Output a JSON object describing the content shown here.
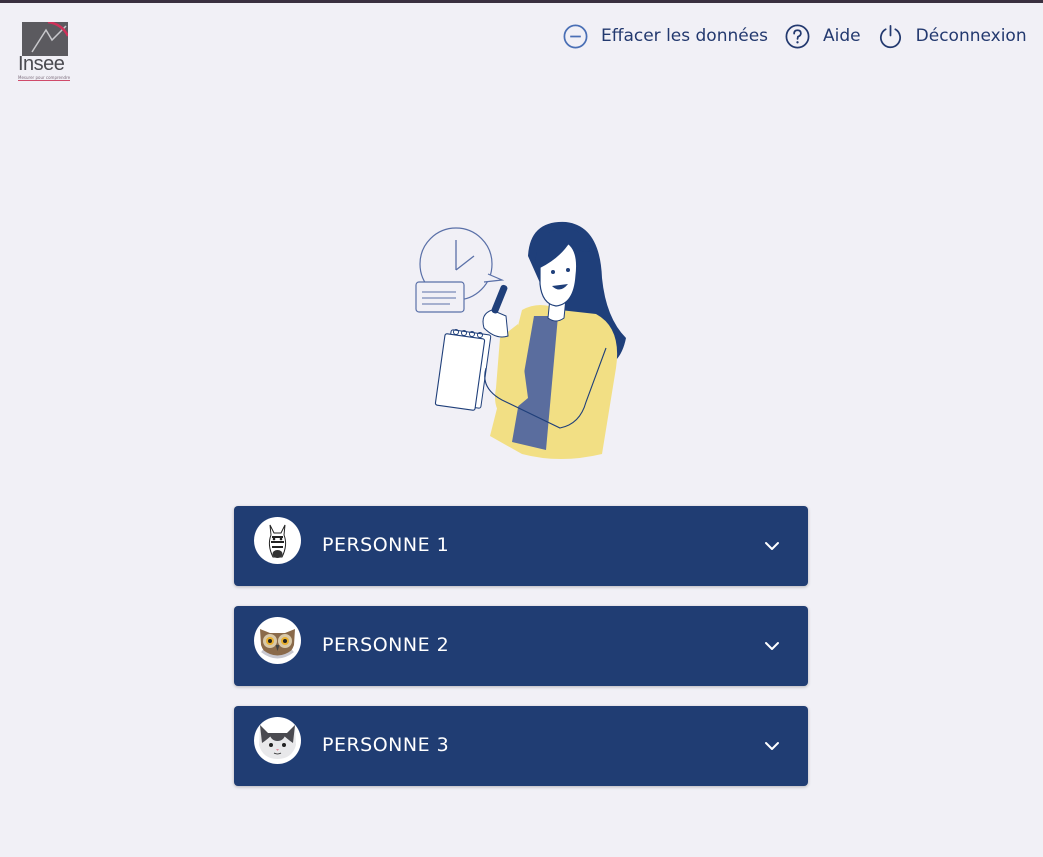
{
  "brand": {
    "name": "Insee",
    "tagline": "Mesurer pour comprendre"
  },
  "toolbar": {
    "clear_label": "Effacer les données",
    "clear_icon": "minus-circle-icon",
    "help_label": "Aide",
    "help_icon": "question-circle-icon",
    "logout_label": "Déconnexion",
    "logout_icon": "power-icon"
  },
  "illustration": {
    "name": "woman-writing-notes-illustration"
  },
  "persons": [
    {
      "label": "PERSONNE 1",
      "avatar_icon": "zebra-icon",
      "expand_icon": "chevron-down-icon"
    },
    {
      "label": "PERSONNE 2",
      "avatar_icon": "owl-icon",
      "expand_icon": "chevron-down-icon"
    },
    {
      "label": "PERSONNE 3",
      "avatar_icon": "cat-icon",
      "expand_icon": "chevron-down-icon"
    }
  ],
  "colors": {
    "background": "#f1f0f6",
    "primary": "#203d73",
    "toolbar_text": "#23396f",
    "illustration_yellow": "#f2df84",
    "illustration_navy": "#1f3f7a"
  }
}
